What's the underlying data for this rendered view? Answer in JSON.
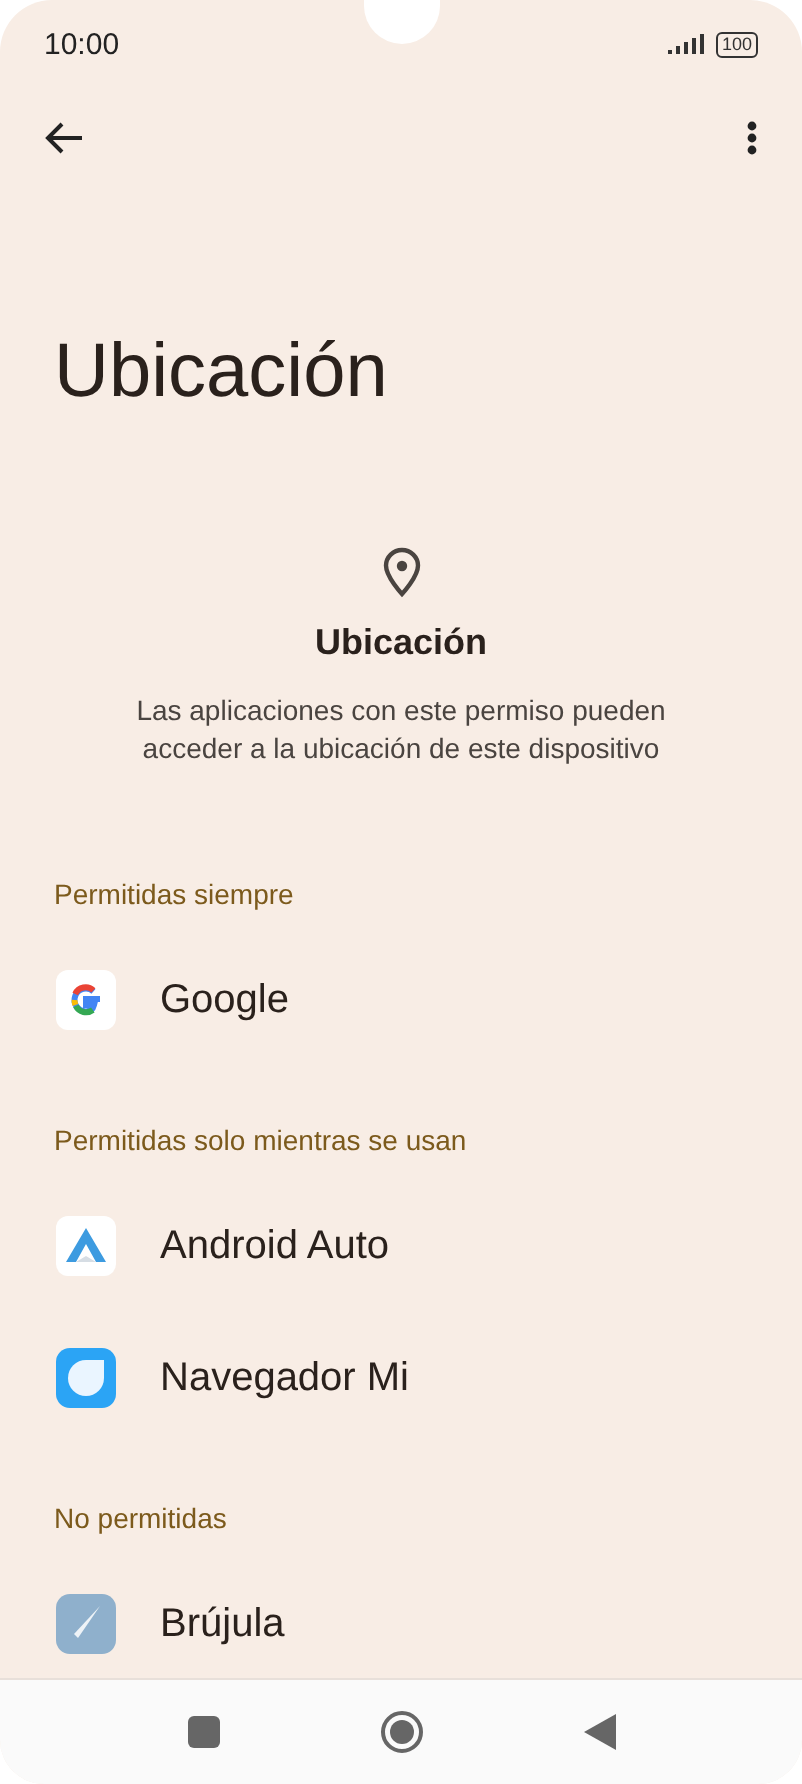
{
  "status_bar": {
    "time": "10:00",
    "battery": "100"
  },
  "title": "Ubicación",
  "permission": {
    "heading": "Ubicación",
    "description": "Las aplicaciones con este permiso pueden acceder a la ubicación de este dispositivo"
  },
  "sections": [
    {
      "header": "Permitidas siempre",
      "apps": [
        {
          "name": "Google",
          "kind": "google"
        }
      ]
    },
    {
      "header": "Permitidas solo mientras se usan",
      "apps": [
        {
          "name": "Android Auto",
          "kind": "auto"
        },
        {
          "name": "Navegador Mi",
          "kind": "browser"
        }
      ]
    },
    {
      "header": "No permitidas",
      "apps": [
        {
          "name": "Brújula",
          "kind": "compass"
        }
      ]
    }
  ]
}
